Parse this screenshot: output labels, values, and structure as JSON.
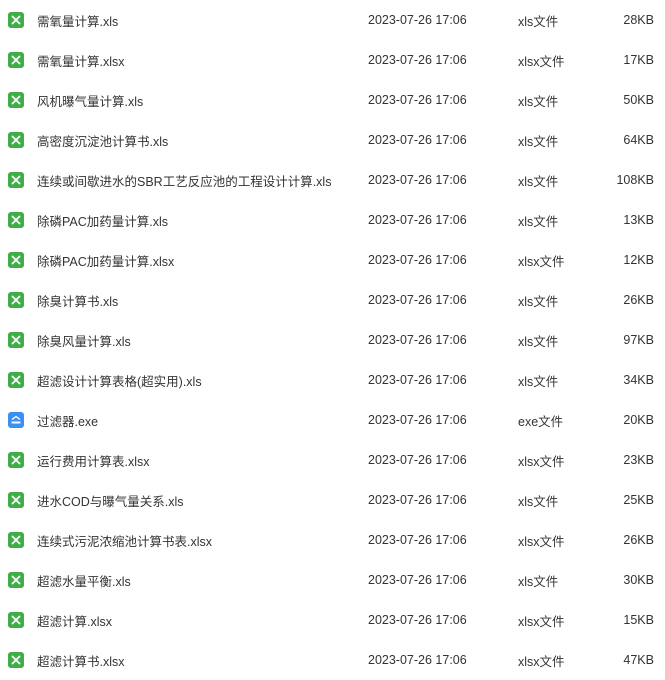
{
  "files": [
    {
      "name": "需氧量计算.xls",
      "modified": "2023-07-26 17:06",
      "type": "xls文件",
      "size": "28KB",
      "icon": "excel-icon"
    },
    {
      "name": "需氧量计算.xlsx",
      "modified": "2023-07-26 17:06",
      "type": "xlsx文件",
      "size": "17KB",
      "icon": "excel-icon"
    },
    {
      "name": "风机曝气量计算.xls",
      "modified": "2023-07-26 17:06",
      "type": "xls文件",
      "size": "50KB",
      "icon": "excel-icon"
    },
    {
      "name": "高密度沉淀池计算书.xls",
      "modified": "2023-07-26 17:06",
      "type": "xls文件",
      "size": "64KB",
      "icon": "excel-icon"
    },
    {
      "name": "连续或间歇进水的SBR工艺反应池的工程设计计算.xls",
      "modified": "2023-07-26 17:06",
      "type": "xls文件",
      "size": "108KB",
      "icon": "excel-icon"
    },
    {
      "name": "除磷PAC加药量计算.xls",
      "modified": "2023-07-26 17:06",
      "type": "xls文件",
      "size": "13KB",
      "icon": "excel-icon"
    },
    {
      "name": "除磷PAC加药量计算.xlsx",
      "modified": "2023-07-26 17:06",
      "type": "xlsx文件",
      "size": "12KB",
      "icon": "excel-icon"
    },
    {
      "name": "除臭计算书.xls",
      "modified": "2023-07-26 17:06",
      "type": "xls文件",
      "size": "26KB",
      "icon": "excel-icon"
    },
    {
      "name": "除臭风量计算.xls",
      "modified": "2023-07-26 17:06",
      "type": "xls文件",
      "size": "97KB",
      "icon": "excel-icon"
    },
    {
      "name": "超滤设计计算表格(超实用).xls",
      "modified": "2023-07-26 17:06",
      "type": "xls文件",
      "size": "34KB",
      "icon": "excel-icon"
    },
    {
      "name": "过滤器.exe",
      "modified": "2023-07-26 17:06",
      "type": "exe文件",
      "size": "20KB",
      "icon": "executable-icon"
    },
    {
      "name": "运行费用计算表.xlsx",
      "modified": "2023-07-26 17:06",
      "type": "xlsx文件",
      "size": "23KB",
      "icon": "excel-icon"
    },
    {
      "name": "进水COD与曝气量关系.xls",
      "modified": "2023-07-26 17:06",
      "type": "xls文件",
      "size": "25KB",
      "icon": "excel-icon"
    },
    {
      "name": "连续式污泥浓缩池计算书表.xlsx",
      "modified": "2023-07-26 17:06",
      "type": "xlsx文件",
      "size": "26KB",
      "icon": "excel-icon"
    },
    {
      "name": "超滤水量平衡.xls",
      "modified": "2023-07-26 17:06",
      "type": "xls文件",
      "size": "30KB",
      "icon": "excel-icon"
    },
    {
      "name": "超滤计算.xlsx",
      "modified": "2023-07-26 17:06",
      "type": "xlsx文件",
      "size": "15KB",
      "icon": "excel-icon"
    },
    {
      "name": "超滤计算书.xlsx",
      "modified": "2023-07-26 17:06",
      "type": "xlsx文件",
      "size": "47KB",
      "icon": "excel-icon"
    }
  ],
  "colors": {
    "excel_icon": "#3fae49",
    "exe_icon": "#3b8ff2",
    "text": "#333333"
  }
}
